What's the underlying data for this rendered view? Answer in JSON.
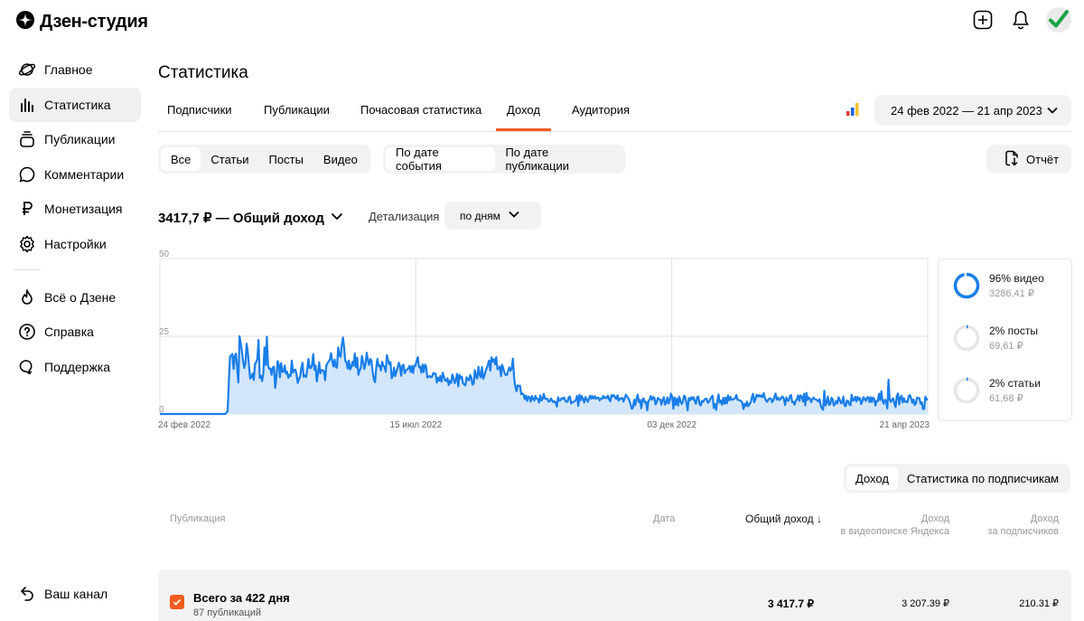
{
  "app": {
    "logo_text": "Дзен-студия"
  },
  "sidebar": {
    "items": [
      {
        "label": "Главное",
        "icon": "planet-icon"
      },
      {
        "label": "Статистика",
        "icon": "bar-chart-icon"
      },
      {
        "label": "Публикации",
        "icon": "layers-icon"
      },
      {
        "label": "Комментарии",
        "icon": "comment-icon"
      },
      {
        "label": "Монетизация",
        "icon": "ruble-icon"
      },
      {
        "label": "Настройки",
        "icon": "gear-icon"
      }
    ],
    "secondary": [
      {
        "label": "Всё о Дзене",
        "icon": "flame-icon"
      },
      {
        "label": "Справка",
        "icon": "help-icon"
      },
      {
        "label": "Поддержка",
        "icon": "support-icon"
      }
    ],
    "bottom": {
      "label": "Ваш канал",
      "icon": "back-arrow-icon"
    }
  },
  "page": {
    "title": "Статистика"
  },
  "tabs": [
    "Подписчики",
    "Публикации",
    "Почасовая статистика",
    "Доход",
    "Аудитория"
  ],
  "active_tab": "Доход",
  "date_range": "24 фев 2022 — 21 апр 2023",
  "filters": {
    "type": [
      "Все",
      "Статьи",
      "Посты",
      "Видео"
    ],
    "type_selected": "Все",
    "date_mode": [
      "По дате события",
      "По дате публикации"
    ],
    "date_mode_selected": "По дате события"
  },
  "report_label": "Отчёт",
  "total_label": "3417,7 ₽ — Общий доход",
  "detail": {
    "label": "Детализация",
    "value": "по дням"
  },
  "chart_data": {
    "type": "area",
    "y_ticks": [
      "50",
      "25",
      "0"
    ],
    "ylim": [
      0,
      50
    ],
    "x_labels": [
      "24 фев 2022",
      "15 июл 2022",
      "03 дек 2022",
      "21 апр 2023"
    ],
    "grid": true,
    "series": [
      {
        "values": [
          0,
          0,
          0,
          0,
          0,
          0,
          0,
          0,
          0,
          0,
          0,
          0,
          0,
          0,
          0,
          0,
          0,
          0,
          0,
          0,
          0,
          0,
          0,
          0,
          0,
          0,
          0,
          0,
          0,
          0,
          0,
          0,
          0,
          0,
          0,
          0,
          0,
          0,
          0,
          0,
          0,
          0,
          0,
          0,
          0,
          0,
          0,
          0,
          0,
          0,
          0,
          0,
          0,
          0,
          0,
          0,
          0.4,
          1.0,
          10.4,
          18.4,
          18.9,
          19.3,
          14.5,
          18.6,
          19.4,
          14.7,
          10.1,
          25.0,
          22.8,
          20.2,
          17.0,
          14.8,
          16.5,
          22.6,
          19.8,
          15.3,
          11.4,
          11.9,
          13.0,
          10.9,
          16.1,
          16.7,
          17.8,
          23.8,
          11.6,
          12.3,
          10.6,
          13.0,
          21.4,
          15.8,
          24.9,
          15.5,
          14.5,
          14.6,
          12.6,
          15.0,
          15.2,
          8.4,
          11.9,
          17.0,
          16.0,
          11.8,
          16.4,
          13.6,
          13.6,
          15.6,
          13.0,
          13.6,
          11.6,
          12.6,
          12.2,
          17.2,
          13.3,
          14.1,
          14.3,
          12.7,
          10.0,
          11.3,
          11.9,
          14.9,
          16.5,
          12.0,
          12.4,
          11.9,
          14.5,
          17.7,
          14.8,
          14.8,
          15.7,
          19.3,
          14.2,
          15.6,
          10.5,
          13.0,
          16.6,
          13.1,
          14.1,
          14.1,
          13.7,
          10.9,
          15.6,
          16.4,
          16.9,
          17.5,
          19.6,
          17.0,
          15.3,
          17.5,
          15.1,
          14.9,
          21.4,
          18.9,
          18.4,
          22.0,
          24.6,
          21.5,
          17.0,
          16.7,
          14.6,
          17.2,
          14.3,
          15.0,
          16.8,
          15.5,
          19.5,
          15.0,
          18.1,
          12.6,
          14.0,
          14.7,
          18.7,
          16.8,
          14.5,
          16.1,
          19.7,
          17.3,
          15.8,
          17.7,
          17.2,
          13.6,
          11.2,
          10.2,
          14.8,
          17.7,
          15.4,
          15.6,
          14.0,
          16.8,
          15.6,
          15.1,
          13.6,
          18.9,
          17.3,
          16.0,
          16.7,
          11.5,
          12.2,
          14.9,
          12.2,
          13.6,
          14.8,
          16.5,
          15.3,
          12.3,
          15.6,
          15.8,
          13.1,
          14.0,
          14.3,
          14.6,
          15.5,
          13.5,
          15.4,
          13.2,
          15.6,
          15.5,
          17.1,
          18.3,
          15.0,
          15.2,
          13.3,
          15.9,
          13.5,
          15.9,
          15.3,
          11.7,
          12.1,
          12.2,
          11.8,
          12.0,
          13.2,
          12.9,
          13.0,
          10.1,
          11.7,
          10.7,
          12.2,
          10.4,
          13.3,
          11.9,
          10.8,
          10.6,
          11.5,
          9.3,
          10.7,
          10.0,
          12.7,
          11.6,
          9.9,
          10.8,
          12.9,
          8.9,
          12.6,
          11.5,
          12.0,
          9.9,
          9.5,
          9.2,
          11.8,
          11.2,
          10.8,
          12.5,
          11.7,
          9.4,
          9.8,
          14.1,
          12.0,
          11.4,
          15.2,
          12.6,
          11.8,
          15.1,
          11.3,
          12.2,
          13.8,
          14.8,
          15.9,
          17.2,
          13.9,
          18.2,
          16.9,
          17.6,
          16.0,
          18.3,
          14.4,
          14.7,
          15.3,
          12.2,
          15.8,
          14.5,
          13.2,
          12.5,
          12.6,
          13.9,
          15.0,
          13.9,
          14.6,
          17.8,
          11.7,
          8.9,
          7.3,
          9.2,
          9.0,
          9.1,
          6.4,
          6.6,
          6.2,
          4.8,
          5.9,
          4.2,
          5.6,
          5.3,
          4.0,
          5.8,
          4.9,
          4.3,
          5.8,
          4.9,
          4.8,
          3.7,
          6.0,
          4.3,
          4.8,
          6.5,
          4.9,
          4.9,
          4.9,
          4.0,
          4.1,
          5.0,
          4.4,
          3.8,
          4.1,
          3.7,
          2.4,
          5.4,
          4.3,
          4.4,
          5.1,
          4.9,
          5.3,
          4.4,
          3.9,
          4.0,
          5.4,
          5.6,
          3.4,
          3.7,
          3.9,
          4.1,
          4.6,
          5.8,
          2.6,
          6.2,
          4.4,
          5.8,
          4.8,
          3.7,
          5.5,
          4.7,
          3.9,
          4.9,
          5.9,
          4.9,
          5.7,
          5.0,
          5.7,
          4.9,
          5.3,
          5.2,
          4.4,
          5.0,
          4.9,
          5.8,
          5.1,
          5.4,
          5.1,
          5.9,
          4.6,
          4.1,
          6.1,
          5.6,
          6.1,
          5.4,
          4.8,
          6.0,
          4.3,
          5.0,
          4.9,
          5.2,
          4.0,
          4.9,
          6.2,
          5.7,
          5.1,
          4.3,
          3.1,
          1.7,
          2.0,
          4.6,
          2.8,
          5.0,
          6.2,
          3.8,
          4.5,
          1.8,
          4.6,
          5.0,
          3.7,
          4.0,
          1.2,
          4.1,
          4.6,
          5.8,
          4.6,
          5.4,
          5.3,
          3.1,
          3.8,
          5.2,
          4.7,
          4.6,
          3.0,
          4.6,
          5.4,
          3.0,
          3.6,
          5.3,
          3.4,
          4.5,
          6.5,
          5.6,
          1.7,
          5.3,
          3.0,
          5.0,
          2.7,
          5.6,
          4.1,
          3.2,
          4.0,
          5.9,
          5.4,
          3.6,
          1.2,
          5.1,
          4.4,
          5.4,
          4.7,
          5.4,
          4.1,
          3.3,
          5.4,
          5.6,
          3.3,
          2.7,
          4.2,
          3.9,
          4.5,
          4.9,
          4.9,
          3.6,
          3.9,
          4.8,
          5.4,
          5.9,
          1.9,
          3.2,
          1.3,
          4.2,
          6.3,
          3.6,
          4.3,
          3.0,
          5.2,
          3.3,
          5.3,
          3.4,
          6.0,
          4.4,
          5.5,
          4.6,
          4.6,
          4.9,
          5.1,
          6.1,
          4.6,
          4.5,
          4.3,
          4.2,
          3.6,
          1.6,
          3.3,
          2.5,
          4.0,
          2.5,
          3.1,
          3.7,
          5.3,
          6.5,
          3.8,
          4.7,
          6.2,
          5.6,
          6.1,
          5.6,
          6.0,
          5.4,
          6.7,
          5.2,
          4.3,
          3.9,
          4.7,
          5.0,
          5.0,
          3.8,
          4.4,
          5.5,
          6.6,
          4.6,
          5.3,
          4.5,
          4.8,
          5.4,
          5.6,
          4.8,
          2.9,
          5.3,
          4.3,
          4.3,
          5.7,
          6.1,
          3.8,
          3.9,
          3.0,
          4.3,
          4.8,
          6.0,
          4.2,
          6.0,
          5.6,
          4.0,
          6.5,
          2.8,
          6.8,
          4.5,
          5.3,
          4.8,
          3.8,
          4.9,
          5.3,
          4.7,
          4.7,
          4.4,
          4.0,
          4.8,
          2.7,
          1.8,
          1.4,
          7.5,
          2.7,
          3.7,
          5.6,
          2.9,
          3.2,
          5.2,
          4.8,
          2.7,
          3.2,
          4.2,
          3.4,
          5.4,
          4.6,
          3.5,
          3.6,
          5.6,
          2.7,
          2.5,
          4.3,
          4.2,
          3.1,
          2.8,
          6.2,
          4.3,
          4.5,
          5.5,
          4.0,
          5.5,
          4.6,
          5.1,
          3.2,
          4.1,
          5.4,
          4.8,
          4.2,
          5.4,
          5.4,
          3.8,
          5.4,
          3.9,
          5.3,
          4.8,
          2.7,
          4.2,
          4.1,
          6.5,
          4.5,
          7.3,
          4.2,
          3.3,
          4.6,
          4.1,
          1.8,
          11.0,
          4.6,
          3.9,
          4.7,
          5.0,
          3.3,
          2.2,
          5.8,
          6.6,
          3.1,
          5.3,
          5.9,
          3.7,
          5.1,
          3.9,
          4.0,
          3.8,
          5.7,
          6.1,
          5.1,
          3.6,
          4.7,
          2.9,
          3.4,
          5.3,
          5.1,
          5.1,
          3.3,
          3.8,
          1.6,
          1.7,
          5.6,
          4.6,
          4.9
        ]
      }
    ]
  },
  "breakdown": [
    {
      "pct": "96% видео",
      "amount": "3286,41 ₽",
      "fraction": 0.96
    },
    {
      "pct": "2% посты",
      "amount": "69,61 ₽",
      "fraction": 0.02
    },
    {
      "pct": "2% статьи",
      "amount": "61,68 ₽",
      "fraction": 0.02
    }
  ],
  "table_toggle": [
    "Доход",
    "Статистика по подписчикам"
  ],
  "table_toggle_selected": "Доход",
  "table": {
    "headers": {
      "publication": "Публикация",
      "date": "Дата",
      "total": "Общий доход ↓",
      "video_search": "Доход\nв видеопоиске Яндекса",
      "subscribers": "Доход\nза подписчиков"
    },
    "total_row": {
      "title": "Всего за 422 дня",
      "subtitle": "87 публикаций",
      "total": "3 417.7 ₽",
      "video_search": "3 207.39 ₽",
      "subscribers": "210.31 ₽"
    }
  },
  "colors": {
    "accent": "#f25c1e",
    "line": "#1a7ee8",
    "fill": "#d3e6fb",
    "ok": "#1aa344"
  }
}
